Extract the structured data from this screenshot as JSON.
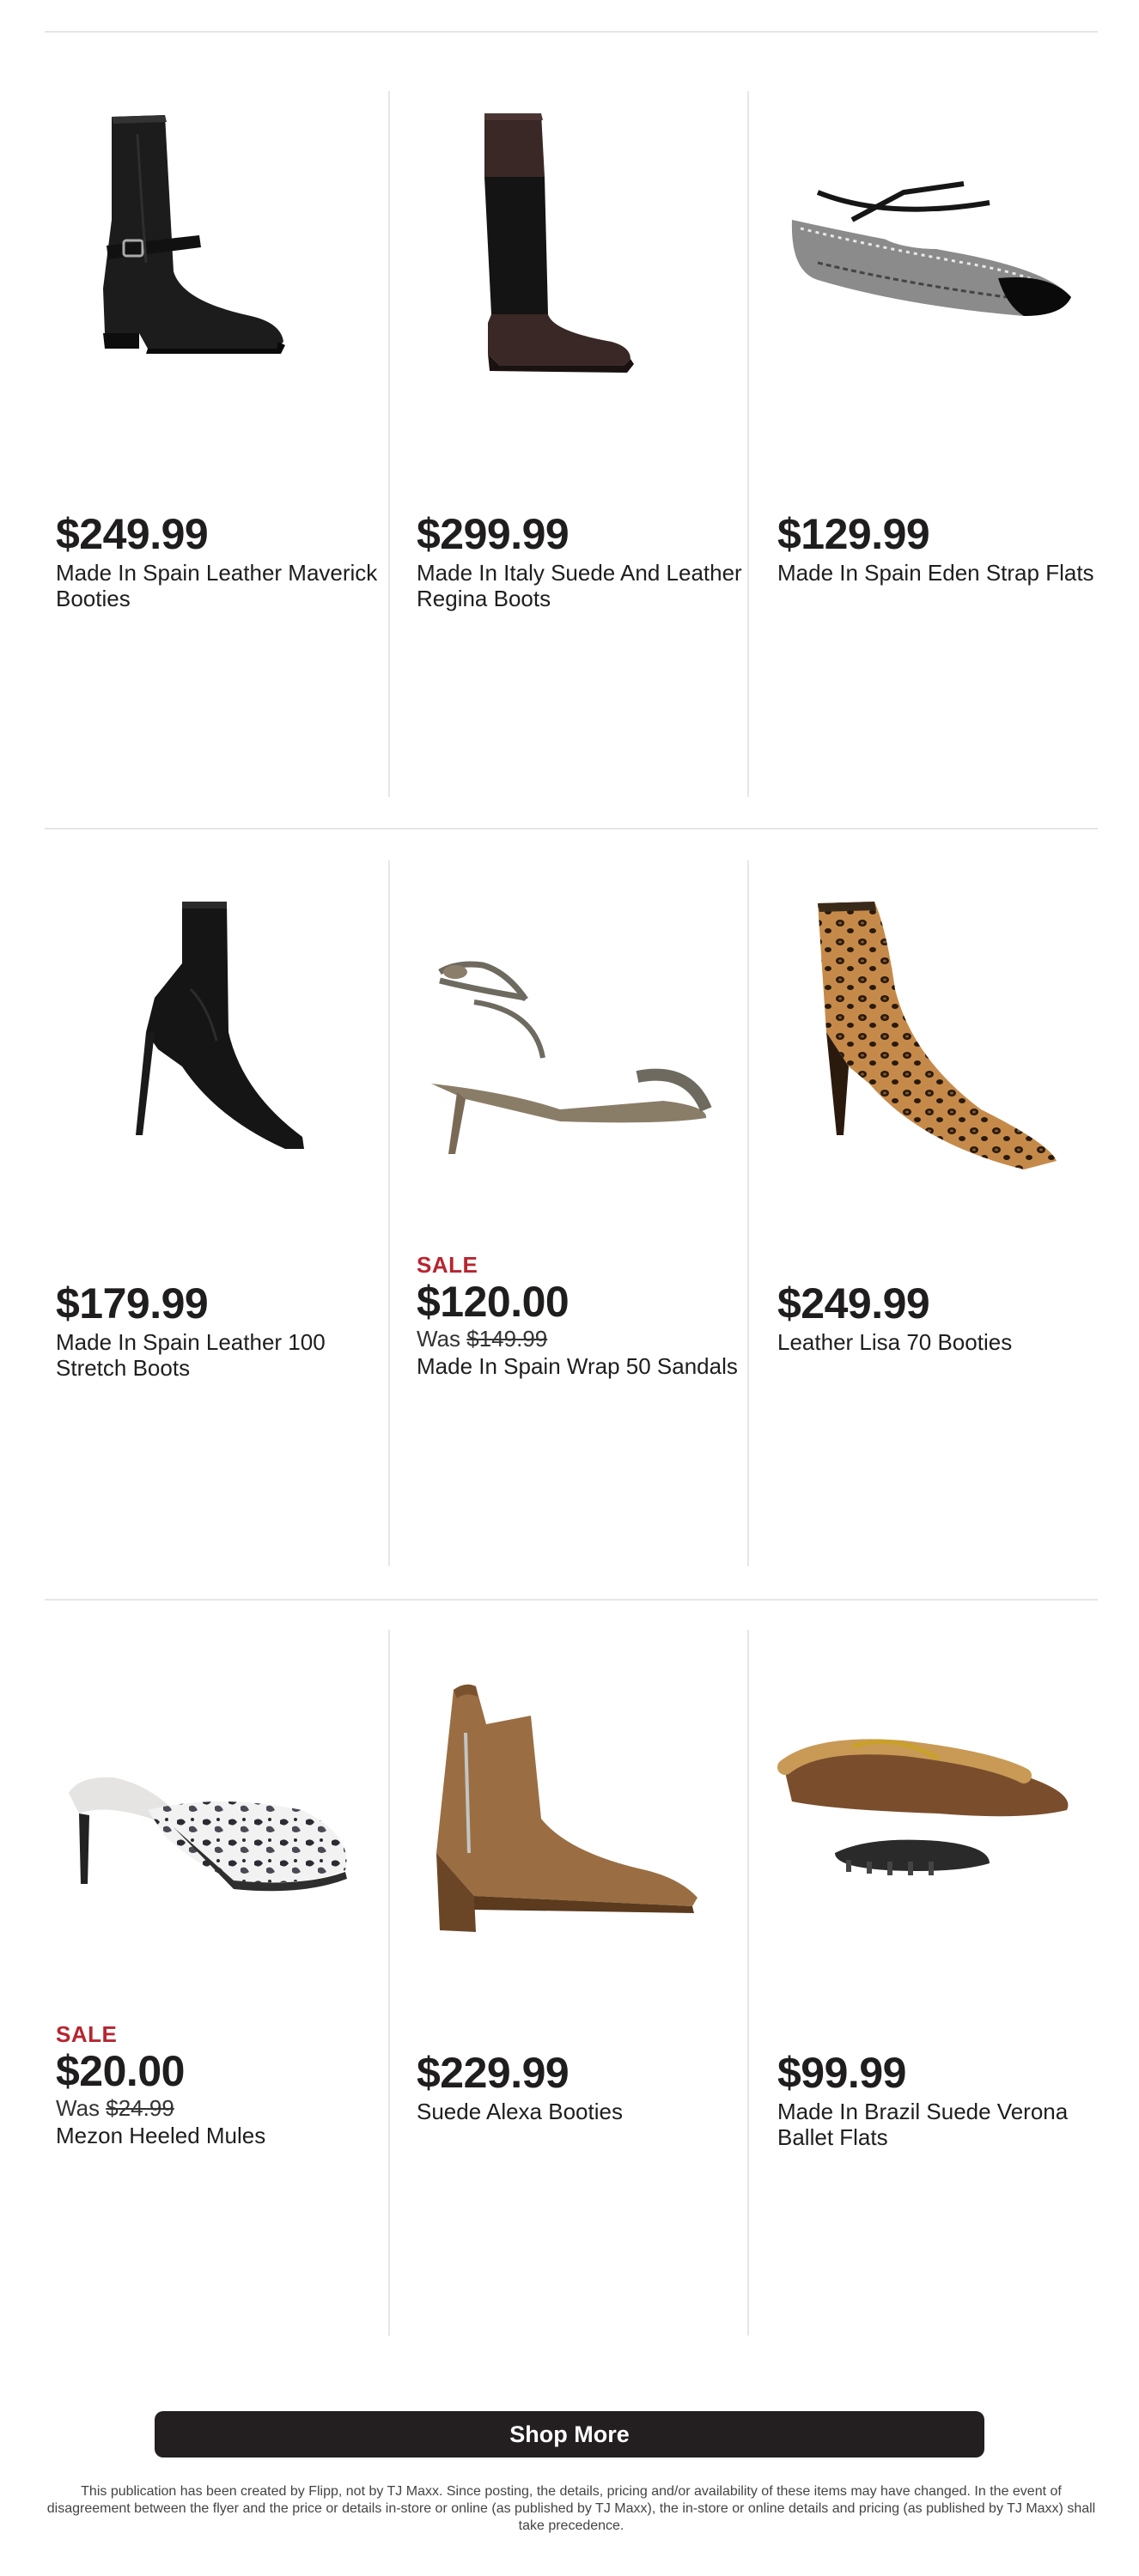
{
  "products": [
    {
      "price": "$249.99",
      "name": "Made In Spain Leather Maverick Booties",
      "sale": "",
      "was_prefix": "",
      "was_price": "",
      "image_icon": "tall-black-leather-buckle-bootie"
    },
    {
      "price": "$299.99",
      "name": "Made In Italy Suede And Leather Regina Boots",
      "sale": "",
      "was_prefix": "",
      "was_price": "",
      "image_icon": "knee-high-suede-leather-boot"
    },
    {
      "price": "$129.99",
      "name": "Made In Spain Eden Strap Flats",
      "sale": "",
      "was_prefix": "",
      "was_price": "",
      "image_icon": "tweed-strap-flat"
    },
    {
      "price": "$179.99",
      "name": "Made In Spain Leather 100 Stretch Boots",
      "sale": "",
      "was_prefix": "",
      "was_price": "",
      "image_icon": "stiletto-sock-boot"
    },
    {
      "price": "$120.00",
      "name": "Made In Spain Wrap 50 Sandals",
      "sale": "SALE",
      "was_prefix": "Was ",
      "was_price": "$149.99",
      "image_icon": "wrap-strap-sandal"
    },
    {
      "price": "$249.99",
      "name": "Leather Lisa 70 Booties",
      "sale": "",
      "was_prefix": "",
      "was_price": "",
      "image_icon": "leopard-print-bootie"
    },
    {
      "price": "$20.00",
      "name": "Mezon Heeled Mules",
      "sale": "SALE",
      "was_prefix": "Was ",
      "was_price": "$24.99",
      "image_icon": "floral-heeled-mule"
    },
    {
      "price": "$229.99",
      "name": "Suede Alexa Booties",
      "sale": "",
      "was_prefix": "",
      "was_price": "",
      "image_icon": "tan-suede-zip-bootie"
    },
    {
      "price": "$99.99",
      "name": "Made In Brazil Suede Verona Ballet Flats",
      "sale": "",
      "was_prefix": "",
      "was_price": "",
      "image_icon": "shearling-ballet-flat"
    }
  ],
  "shop_more_label": "Shop More",
  "disclaimer": "This publication has been created by Flipp, not by TJ Maxx. Since posting, the details, pricing and/or availability of these items may have changed. In the event of disagreement between the flyer and the price or details in-store or online (as published by TJ Maxx), the in-store or online details and pricing (as published by TJ Maxx) shall take precedence.",
  "colors": {
    "sale_red": "#b7252f",
    "button_bg": "#231f20",
    "text": "#1f1d1e",
    "divider": "#e6e6e6"
  }
}
